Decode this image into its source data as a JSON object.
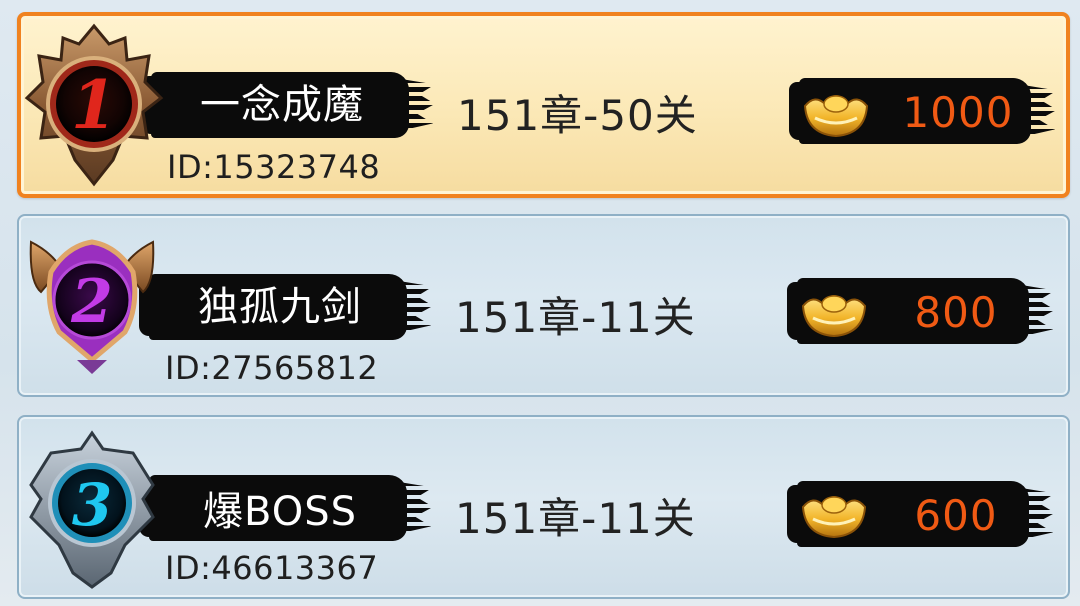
{
  "rows": [
    {
      "rank": "1",
      "name": "一念成魔",
      "id_text": "ID:15323748",
      "progress": "151章-50关",
      "reward": "1000",
      "highlighted": true,
      "accent": "#f0821f"
    },
    {
      "rank": "2",
      "name": "独孤九剑",
      "id_text": "ID:27565812",
      "progress": "151章-11关",
      "reward": "800",
      "highlighted": false,
      "accent": "#8fb0c6"
    },
    {
      "rank": "3",
      "name": "爆BOSS",
      "id_text": "ID:46613367",
      "progress": "151章-11关",
      "reward": "600",
      "highlighted": false,
      "accent": "#8fb0c6"
    }
  ],
  "colors": {
    "reward_text": "#f05a14",
    "rank1_numeral": "#e0261c",
    "rank2_numeral": "#c23be6",
    "rank3_numeral": "#1fc8f0"
  },
  "icons": {
    "rank1": "rank-1-bronze-crest-icon",
    "rank2": "rank-2-purple-crest-icon",
    "rank3": "rank-3-silver-crest-icon",
    "reward": "gold-ingot-icon"
  }
}
